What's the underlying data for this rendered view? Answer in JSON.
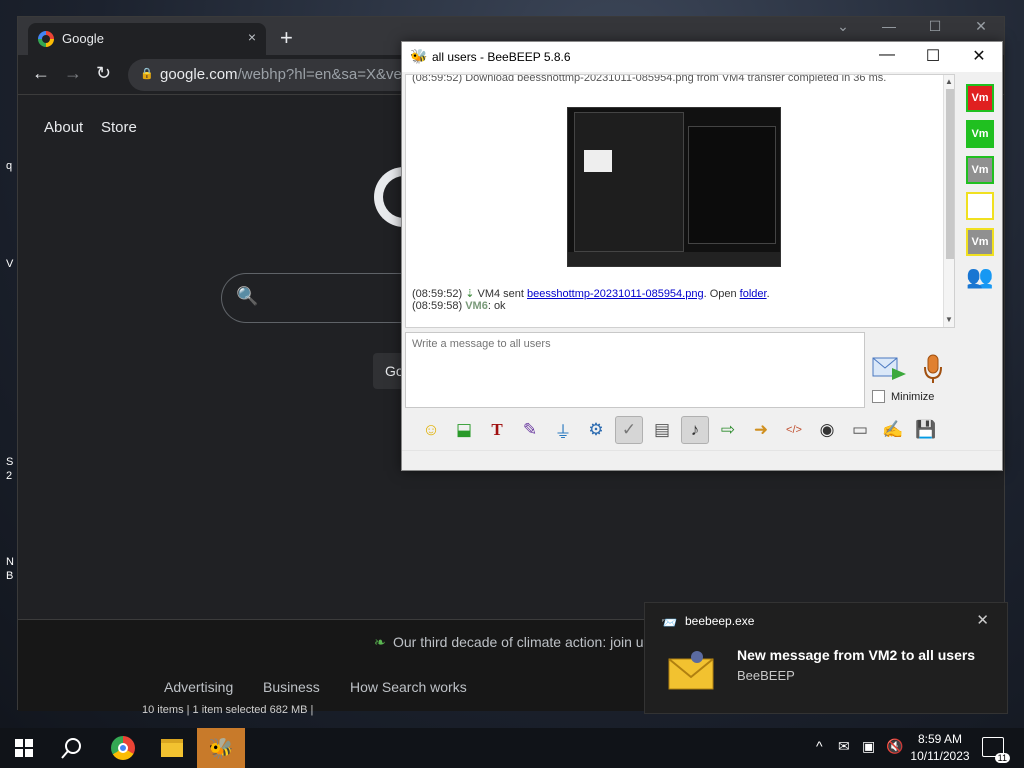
{
  "desktop": {
    "icon_labels": [
      "q",
      "V",
      "S",
      "2",
      "N",
      "B"
    ]
  },
  "chrome": {
    "tab_title": "Google",
    "tab_close": "×",
    "new_tab": "+",
    "url_host": "google.com",
    "url_path": "/webhp?hl=en&sa=X&ved=",
    "links": {
      "about": "About",
      "store": "Store"
    },
    "search_button_partial": "Go",
    "climate_text": "Our third decade of climate action: join u",
    "footer_links": [
      "Advertising",
      "Business",
      "How Search works"
    ],
    "window_buttons": {
      "chevron": "⌄",
      "min": "—",
      "max": "☐",
      "close": "✕"
    }
  },
  "explorer_status": "10 items  |  1 item selected  682 MB  |",
  "beebeep": {
    "window_title": "all users - BeeBEEP 5.8.6",
    "window_buttons": {
      "min": "—",
      "max": "☐",
      "close": "✕"
    },
    "chat": {
      "partial_top_line": "(08:59:52)      Download beesshottmp-20231011-085954.png from VM4 transfer completed in 36 ms.",
      "msg1": {
        "time": "(08:59:52)",
        "sender": "VM4 sent ",
        "file": "beesshottmp-20231011-085954.png",
        "mid": ". Open ",
        "folder": "folder",
        "end": "."
      },
      "msg2": {
        "time": "(08:59:58) ",
        "user": "VM6",
        "text": ": ok"
      }
    },
    "input_placeholder": "Write a message to all users",
    "minimize_label": "Minimize",
    "users": [
      {
        "label": "Vm",
        "fill": "#e02020",
        "border": "#20c020"
      },
      {
        "label": "Vm",
        "fill": "#20c020",
        "border": "#20c020"
      },
      {
        "label": "Vm",
        "fill": "#909090",
        "border": "#20c020"
      },
      {
        "label": "",
        "fill": "#ffffff",
        "border": "#f0e020"
      },
      {
        "label": "Vm",
        "fill": "#909090",
        "border": "#f0e020"
      }
    ]
  },
  "notification": {
    "app": "beebeep.exe",
    "close": "✕",
    "title": "New message from VM2 to all users",
    "subtitle": "BeeBEEP"
  },
  "taskbar": {
    "time": "8:59 AM",
    "date": "10/11/2023",
    "notification_count": "11"
  }
}
